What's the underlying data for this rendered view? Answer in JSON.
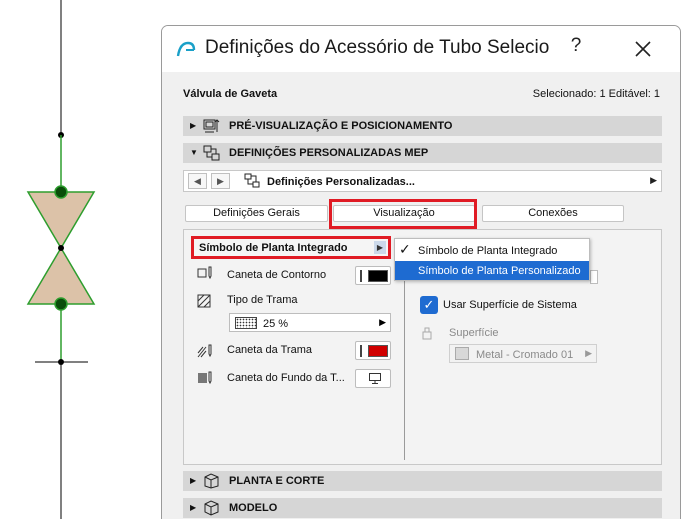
{
  "dialog": {
    "title": "Definições do Acessório de Tubo Selecio",
    "help_label": "?",
    "element_name": "Válvula de Gaveta",
    "selection_info": "Selecionado: 1 Editável: 1"
  },
  "sections": {
    "preview": "PRÉ-VISUALIZAÇÃO E POSICIONAMENTO",
    "mep_custom": "DEFINIÇÕES PERSONALIZADAS MEP",
    "plan_section": "PLANTA E CORTE",
    "model": "MODELO"
  },
  "nav": {
    "back_label": "◀",
    "forward_label": "▶",
    "current_page": "Definições Personalizadas...",
    "arrow": "▶"
  },
  "tabs": [
    {
      "label": "Definições Gerais"
    },
    {
      "label": "Visualização"
    },
    {
      "label": "Conexões"
    }
  ],
  "left_panel": {
    "symbol_dropdown": "Símbolo de Planta Integrado",
    "contour_pen": "Caneta de Contorno",
    "contour_pen_color": "#000000",
    "hatch_type": "Tipo de Trama",
    "hatch_value": "25 %",
    "hatch_pen": "Caneta da Trama",
    "hatch_pen_color": "#d00000",
    "hatch_bg_pen": "Caneta do Fundo da T..."
  },
  "popup_menu": {
    "items": [
      {
        "label": "Símbolo de Planta Integrado",
        "checked": true
      },
      {
        "label": "Símbolo de Planta Personalizado",
        "highlighted": true
      }
    ]
  },
  "right_panel": {
    "use_system_surface": "Usar Superfície de Sistema",
    "use_system_surface_checked": true,
    "surface_label": "Superfície",
    "surface_value": "Metal - Cromado 01"
  },
  "colors": {
    "accent": "#1e6bd1",
    "highlight_red": "#e01b24",
    "valve_fill": "#dcc2a8",
    "pipe_green": "#2e9e2e"
  }
}
